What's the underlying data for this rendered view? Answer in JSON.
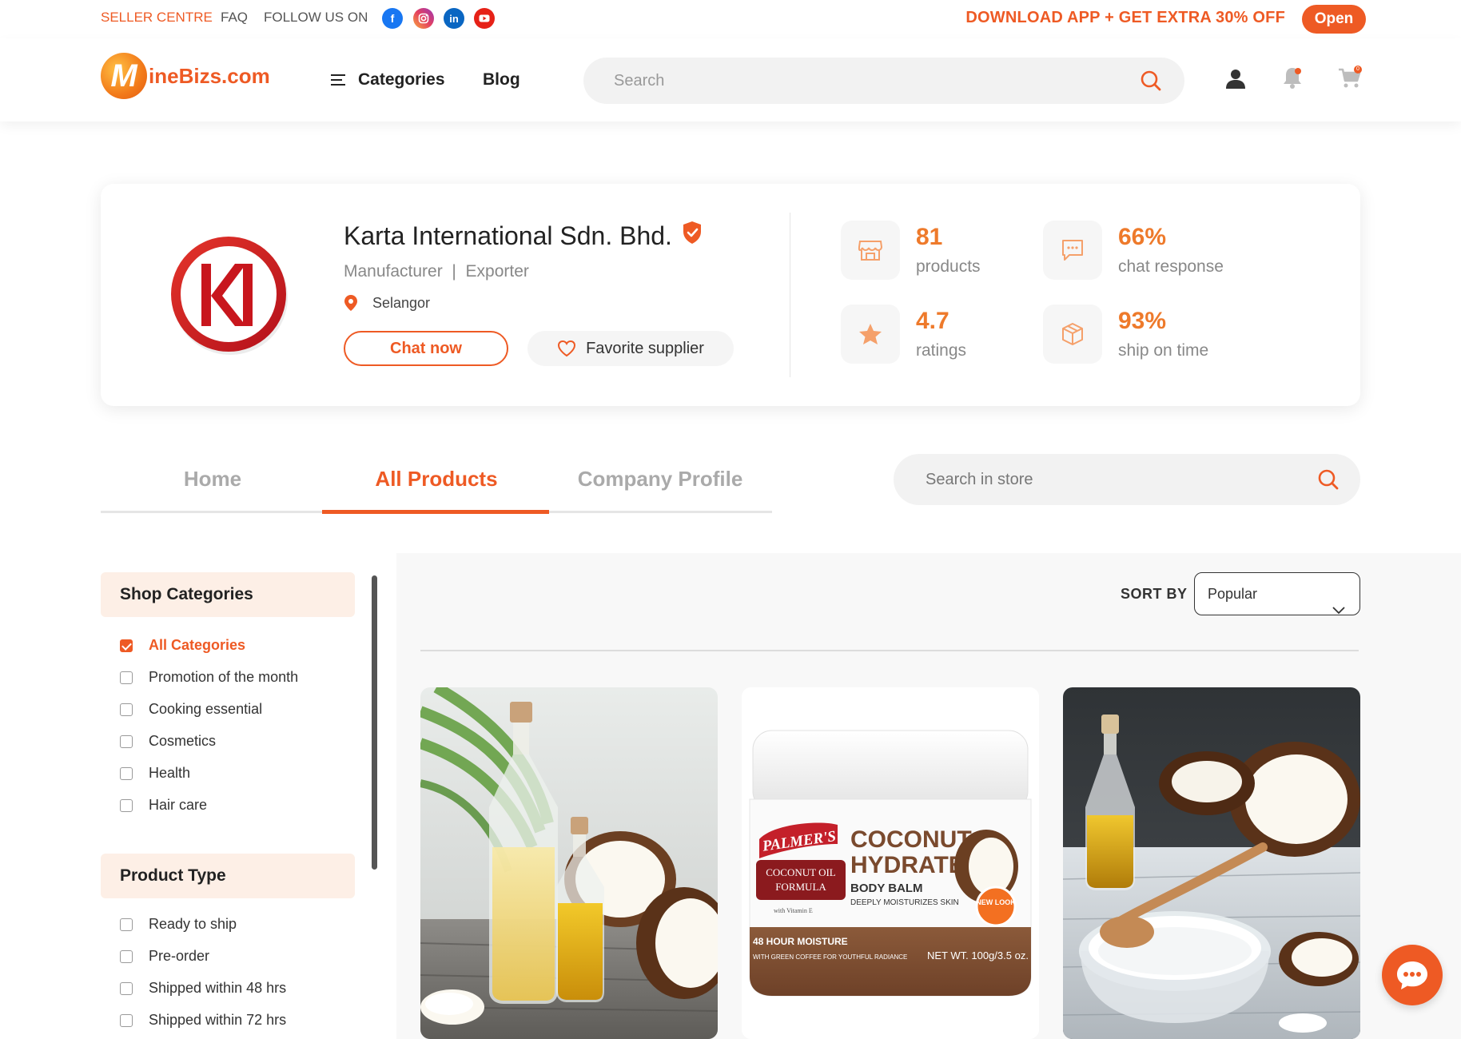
{
  "topbar": {
    "seller_centre": "SELLER CENTRE",
    "faq": "FAQ",
    "follow_us": "FOLLOW US ON",
    "social": [
      "facebook-icon",
      "instagram-icon",
      "linkedin-icon",
      "youtube-icon"
    ],
    "promo": "DOWNLOAD APP + GET EXTRA 30% OFF",
    "open_label": "Open"
  },
  "header": {
    "logo_letter": "M",
    "logo_text": "ineBizs.com",
    "categories_label": "Categories",
    "blog_label": "Blog",
    "search_placeholder": "Search",
    "cart_count": "0"
  },
  "store": {
    "name": "Karta International Sdn. Bhd.",
    "type": "Manufacturer  |  Exporter",
    "location": "Selangor",
    "chat_label": "Chat now",
    "favorite_label": "Favorite supplier",
    "stats": {
      "products": {
        "value": "81",
        "label": "products"
      },
      "chat": {
        "value": "66%",
        "label": "chat response"
      },
      "ratings": {
        "value": "4.7",
        "label": "ratings"
      },
      "ship": {
        "value": "93%",
        "label": "ship on time"
      }
    }
  },
  "tabs": {
    "home": "Home",
    "all_products": "All Products",
    "company_profile": "Company Profile",
    "active": "All Products",
    "store_search_placeholder": "Search in store"
  },
  "sidebar": {
    "shop_categories_title": "Shop Categories",
    "categories": [
      {
        "label": "All Categories",
        "checked": true
      },
      {
        "label": "Promotion of the month",
        "checked": false
      },
      {
        "label": "Cooking essential",
        "checked": false
      },
      {
        "label": "Cosmetics",
        "checked": false
      },
      {
        "label": "Health",
        "checked": false
      },
      {
        "label": "Hair care",
        "checked": false
      }
    ],
    "product_type_title": "Product Type",
    "product_types": [
      {
        "label": "Ready to ship",
        "checked": false
      },
      {
        "label": "Pre-order",
        "checked": false
      },
      {
        "label": "Shipped within 48 hrs",
        "checked": false
      },
      {
        "label": "Shipped within 72 hrs",
        "checked": false
      }
    ]
  },
  "main": {
    "sort_by_label": "SORT BY",
    "sort_value": "Popular",
    "products": [
      {
        "image": "coconut-oil-bottles"
      },
      {
        "image": "palmers-coconut-jar",
        "brand": "PALMER'S",
        "line1": "COCONUT OIL",
        "line2": "FORMULA",
        "line3": "with Vitamin E",
        "title1": "COCONUT",
        "title2": "HYDRATE",
        "subtitle": "BODY BALM",
        "desc": "DEEPLY MOISTURIZES SKIN",
        "badge": "NEW LOOK",
        "band1": "48 HOUR MOISTURE",
        "band2": "WITH GREEN COFFEE FOR YOUTHFUL RADIANCE",
        "net_wt": "NET WT. 100g/3.5 oz."
      },
      {
        "image": "coconut-oil-and-flakes"
      }
    ]
  },
  "colors": {
    "brand_orange": "#EE5A24",
    "stat_orange": "#EE7A2B",
    "sidebar_head_bg": "#FDEFE6"
  }
}
